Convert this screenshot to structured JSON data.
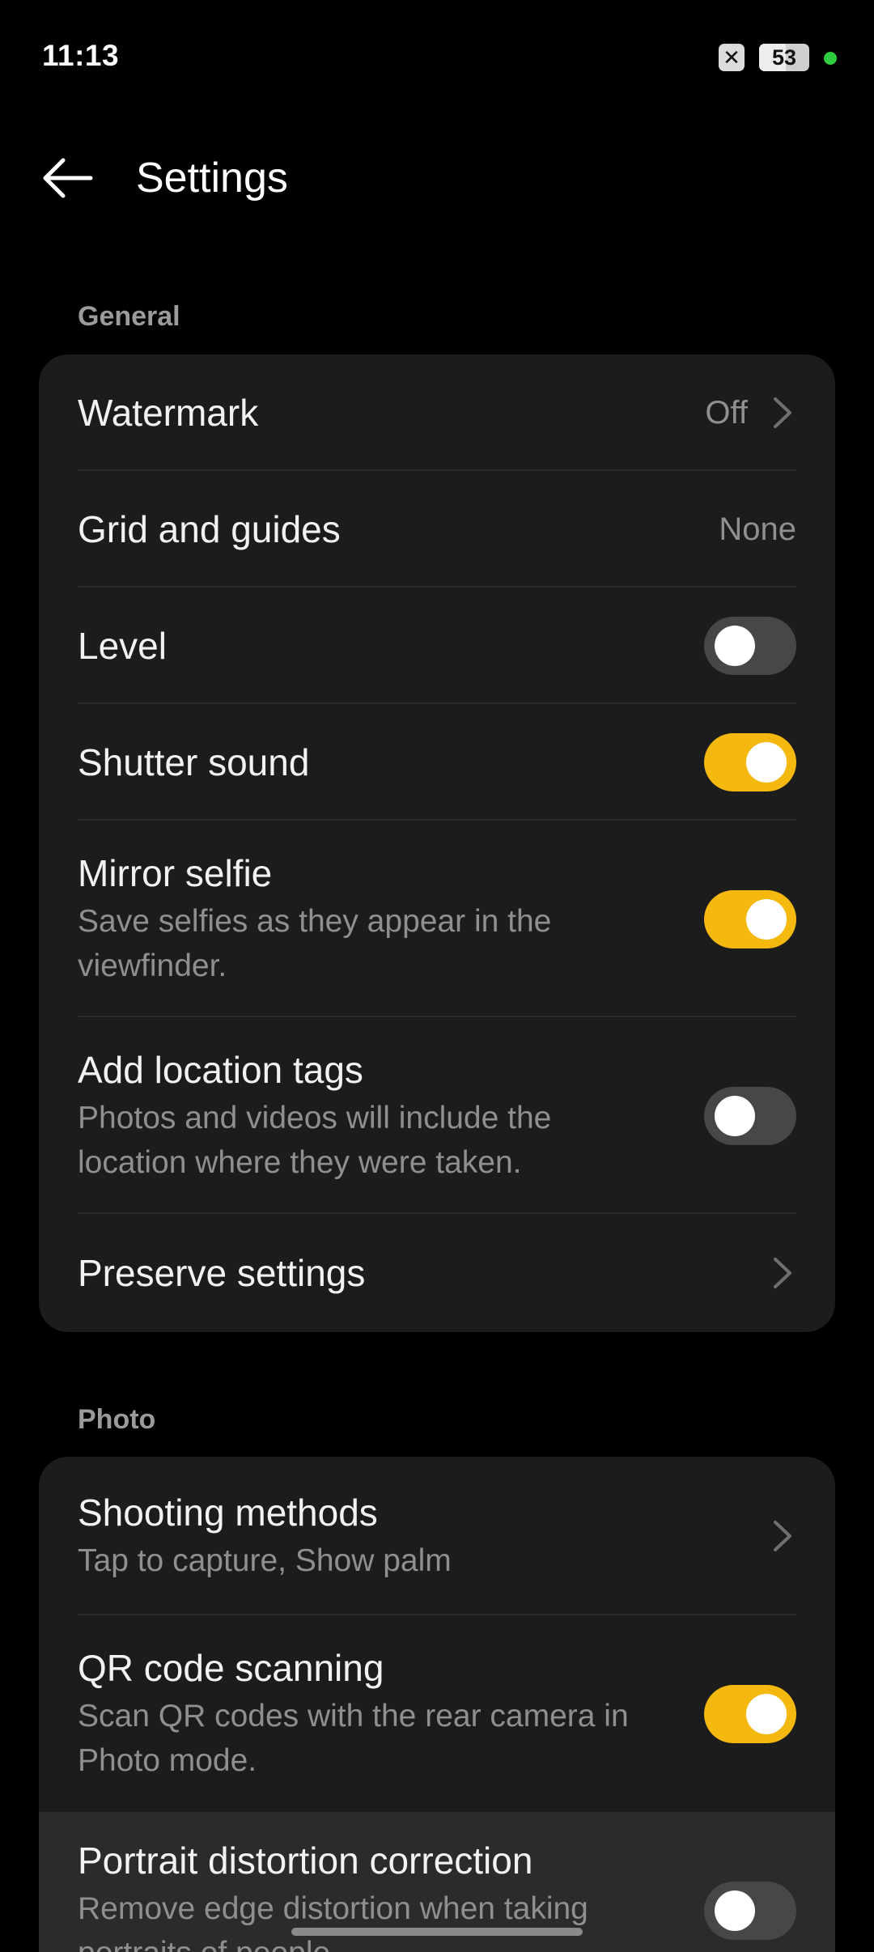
{
  "status_bar": {
    "time": "11:13",
    "notification_icon": "close-box-icon",
    "notification_glyph": "✕",
    "battery_percent": 53,
    "battery_text": "53",
    "indicator_color": "#2ecc40"
  },
  "app_bar": {
    "back_icon": "arrow-left-icon",
    "title": "Settings"
  },
  "accent_color": "#f4b80f",
  "general": {
    "label": "General",
    "items": [
      {
        "title": "Watermark",
        "value": "Off",
        "type": "value-chevron"
      },
      {
        "title": "Grid and guides",
        "value": "None",
        "type": "value"
      },
      {
        "title": "Level",
        "type": "toggle",
        "on": false
      },
      {
        "title": "Shutter sound",
        "type": "toggle",
        "on": true
      },
      {
        "title": "Mirror selfie",
        "subtitle_line1": "Save selfies as they appear in the",
        "subtitle_line2": "viewfinder.",
        "type": "toggle",
        "on": true
      },
      {
        "title": "Add location tags",
        "subtitle_line1": "Photos and videos will include the",
        "subtitle_line2": "location where they were taken.",
        "type": "toggle",
        "on": false
      },
      {
        "title": "Preserve settings",
        "type": "chevron"
      }
    ]
  },
  "photo": {
    "label": "Photo",
    "items": [
      {
        "title": "Shooting methods",
        "subtitle_line1": "Tap to capture, Show palm",
        "type": "chevron"
      },
      {
        "title": "QR code scanning",
        "subtitle_line1": "Scan QR codes with the rear camera in",
        "subtitle_line2": "Photo mode.",
        "type": "toggle",
        "on": true
      },
      {
        "title": "Portrait distortion correction",
        "subtitle_line1": "Remove edge distortion when taking",
        "subtitle_line2": "portraits of people.",
        "type": "toggle",
        "on": false
      }
    ]
  }
}
